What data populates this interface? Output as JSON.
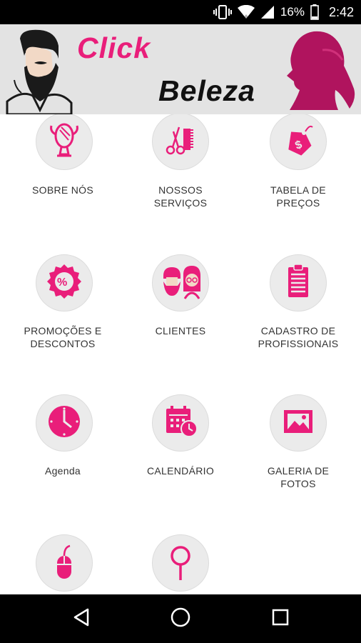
{
  "status_bar": {
    "battery": "16%",
    "time": "2:42"
  },
  "banner": {
    "title_line1": "Click",
    "title_line2": "Beleza"
  },
  "menu": [
    {
      "icon": "mirror-icon",
      "label": "SOBRE NÓS"
    },
    {
      "icon": "scissors-comb-icon",
      "label": "NOSSOS\nSERVIÇOS"
    },
    {
      "icon": "price-tag-icon",
      "label": "TABELA DE\nPREÇOS"
    },
    {
      "icon": "discount-badge-icon",
      "label": "PROMOÇÕES E\nDESCONTOS"
    },
    {
      "icon": "clients-icon",
      "label": "CLIENTES"
    },
    {
      "icon": "clipboard-icon",
      "label": "CADASTRO DE\nPROFISSIONAIS"
    },
    {
      "icon": "clock-icon",
      "label": "Agenda"
    },
    {
      "icon": "calendar-icon",
      "label": "CALENDÁRIO"
    },
    {
      "icon": "gallery-icon",
      "label": "GALERIA DE\nFOTOS"
    },
    {
      "icon": "mouse-icon",
      "label": ""
    },
    {
      "icon": "map-pin-icon",
      "label": ""
    }
  ],
  "nav": {
    "back": "back-icon",
    "home": "home-icon",
    "recents": "recents-icon"
  },
  "colors": {
    "accent": "#e91e7a",
    "circle_bg": "#ebebeb"
  }
}
